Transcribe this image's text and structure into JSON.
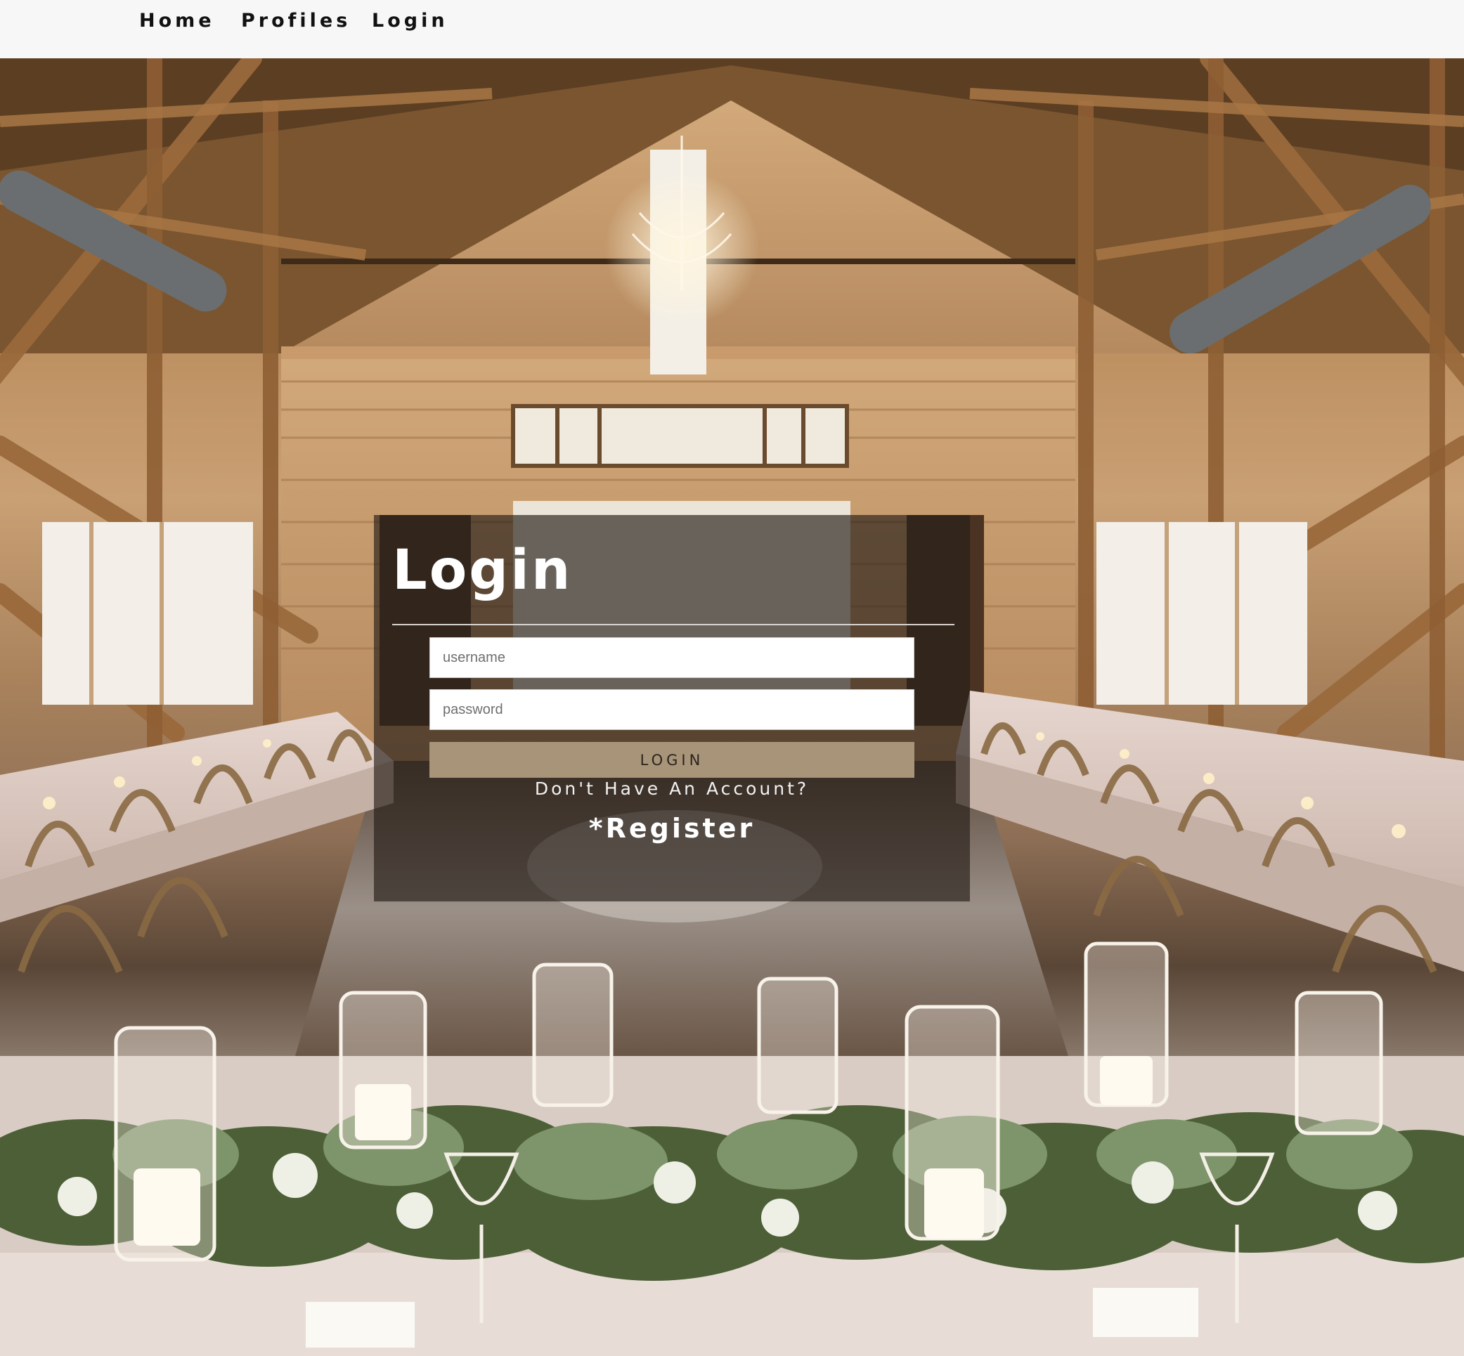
{
  "nav": {
    "items": [
      {
        "label": "Home"
      },
      {
        "label": "Profiles"
      },
      {
        "label": "Login"
      }
    ]
  },
  "login": {
    "title": "Login",
    "username_placeholder": "username",
    "password_placeholder": "password",
    "button_label": "LOGIN",
    "no_account_text": "Don't Have An Account?",
    "register_label": "*Register"
  },
  "colors": {
    "nav_background": "#f7f7f7",
    "panel_overlay": "rgba(38,30,24,0.66)",
    "button_background": "#a89478",
    "text_light": "#ffffff"
  }
}
